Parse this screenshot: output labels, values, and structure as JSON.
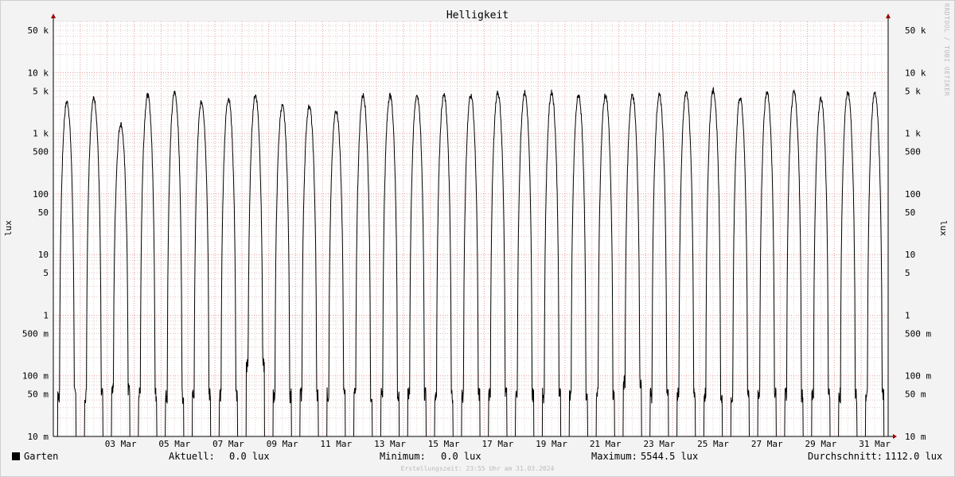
{
  "chart_data": {
    "type": "line",
    "title": "Helligkeit",
    "ylabel": "lux",
    "yscale": "log",
    "ylim": [
      0.01,
      70000
    ],
    "xlim": [
      "2024-03-01 00:00",
      "2024-03-31 23:55"
    ],
    "grid": true,
    "y_ticks": [
      {
        "value": 50000,
        "label": "50 k"
      },
      {
        "value": 10000,
        "label": "10 k"
      },
      {
        "value": 5000,
        "label": "5 k"
      },
      {
        "value": 1000,
        "label": "1 k"
      },
      {
        "value": 500,
        "label": "500"
      },
      {
        "value": 100,
        "label": "100"
      },
      {
        "value": 50,
        "label": "50"
      },
      {
        "value": 10,
        "label": "10"
      },
      {
        "value": 5,
        "label": "5"
      },
      {
        "value": 1,
        "label": "1"
      },
      {
        "value": 0.5,
        "label": "500 m"
      },
      {
        "value": 0.1,
        "label": "100 m"
      },
      {
        "value": 0.05,
        "label": "50 m"
      },
      {
        "value": 0.01,
        "label": "10 m"
      }
    ],
    "x_ticks": [
      {
        "day": 3,
        "label": "03 Mar"
      },
      {
        "day": 5,
        "label": "05 Mar"
      },
      {
        "day": 7,
        "label": "07 Mar"
      },
      {
        "day": 9,
        "label": "09 Mar"
      },
      {
        "day": 11,
        "label": "11 Mar"
      },
      {
        "day": 13,
        "label": "13 Mar"
      },
      {
        "day": 15,
        "label": "15 Mar"
      },
      {
        "day": 17,
        "label": "17 Mar"
      },
      {
        "day": 19,
        "label": "19 Mar"
      },
      {
        "day": 21,
        "label": "21 Mar"
      },
      {
        "day": 23,
        "label": "23 Mar"
      },
      {
        "day": 25,
        "label": "25 Mar"
      },
      {
        "day": 27,
        "label": "27 Mar"
      },
      {
        "day": 29,
        "label": "29 Mar"
      },
      {
        "day": 31,
        "label": "31 Mar"
      }
    ],
    "series": [
      {
        "name": "Garten",
        "color": "#000000",
        "daily_peak_lux": [
          3500,
          4000,
          1500,
          4500,
          5000,
          3500,
          4000,
          4500,
          3000,
          3000,
          2500,
          4500,
          4500,
          4500,
          4500,
          4500,
          5000,
          5000,
          5000,
          4500,
          4500,
          4500,
          4500,
          5000,
          5500,
          4000,
          5000,
          5000,
          4000,
          5000,
          5000
        ],
        "daily_night_lux": [
          0.05,
          0.05,
          0.06,
          0.05,
          0.05,
          0.05,
          0.05,
          0.15,
          0.05,
          0.05,
          0.05,
          0.05,
          0.05,
          0.05,
          0.05,
          0.05,
          0.05,
          0.05,
          0.05,
          0.05,
          0.05,
          0.08,
          0.05,
          0.05,
          0.05,
          0.05,
          0.05,
          0.05,
          0.05,
          0.05,
          0.05
        ]
      }
    ]
  },
  "side_label": "RRDTOOL / TOBI OETIKER",
  "legend": {
    "name": "Garten",
    "current_label": "Aktuell:",
    "current_value": "0.0 lux",
    "min_label": "Minimum:",
    "min_value": "0.0 lux",
    "max_label": "Maximum:",
    "max_value": "5544.5 lux",
    "avg_label": "Durchschnitt:",
    "avg_value": "1112.0 lux"
  },
  "footer": "Erstellungszeit: 23:55 Uhr am 31.03.2024"
}
